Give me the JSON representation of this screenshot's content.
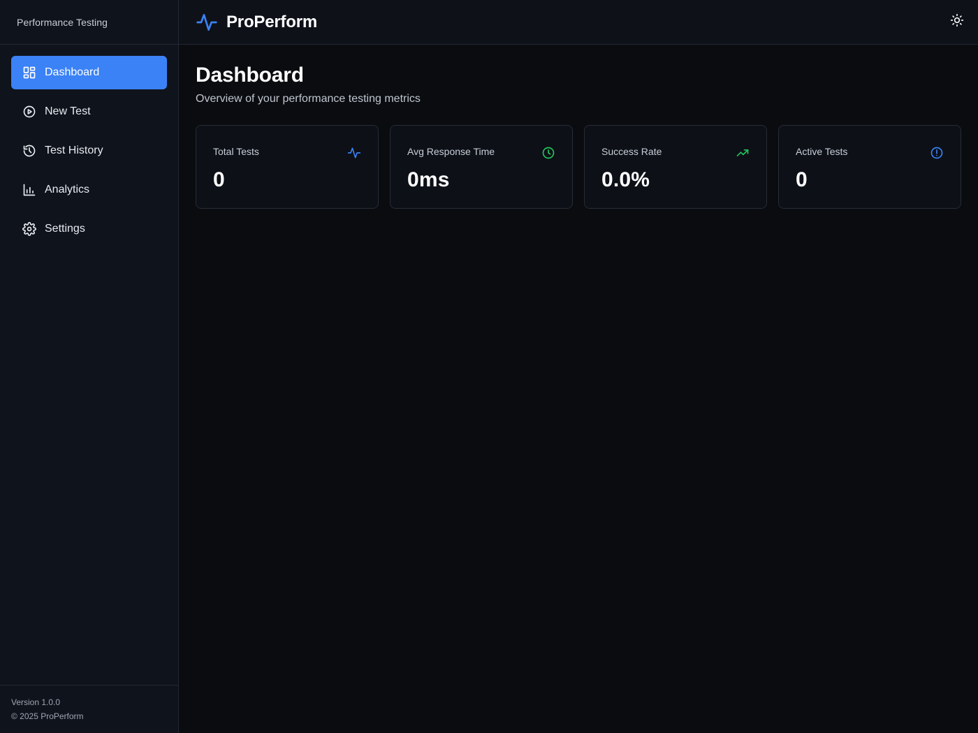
{
  "app": {
    "sidebar_brand": "Performance Testing",
    "title": "ProPerform"
  },
  "sidebar": {
    "items": [
      {
        "label": "Dashboard",
        "icon": "dashboard-icon",
        "active": true
      },
      {
        "label": "New Test",
        "icon": "play-circle-icon",
        "active": false
      },
      {
        "label": "Test History",
        "icon": "history-icon",
        "active": false
      },
      {
        "label": "Analytics",
        "icon": "bar-chart-icon",
        "active": false
      },
      {
        "label": "Settings",
        "icon": "gear-icon",
        "active": false
      }
    ],
    "footer": {
      "version": "Version 1.0.0",
      "copyright": "© 2025 ProPerform"
    }
  },
  "header": {
    "theme_icon": "sun-icon"
  },
  "main": {
    "title": "Dashboard",
    "subtitle": "Overview of your performance testing metrics",
    "metrics": [
      {
        "label": "Total Tests",
        "value": "0",
        "icon": "activity-icon",
        "color": "#3b82f6"
      },
      {
        "label": "Avg Response Time",
        "value": "0ms",
        "icon": "clock-icon",
        "color": "#22c55e"
      },
      {
        "label": "Success Rate",
        "value": "0.0%",
        "icon": "trending-up-icon",
        "color": "#22c55e"
      },
      {
        "label": "Active Tests",
        "value": "0",
        "icon": "alert-circle-icon",
        "color": "#3b82f6"
      }
    ]
  },
  "colors": {
    "accent": "#3b82f6",
    "success": "#22c55e",
    "background": "#0a0c10",
    "sidebar": "#0f131b"
  }
}
